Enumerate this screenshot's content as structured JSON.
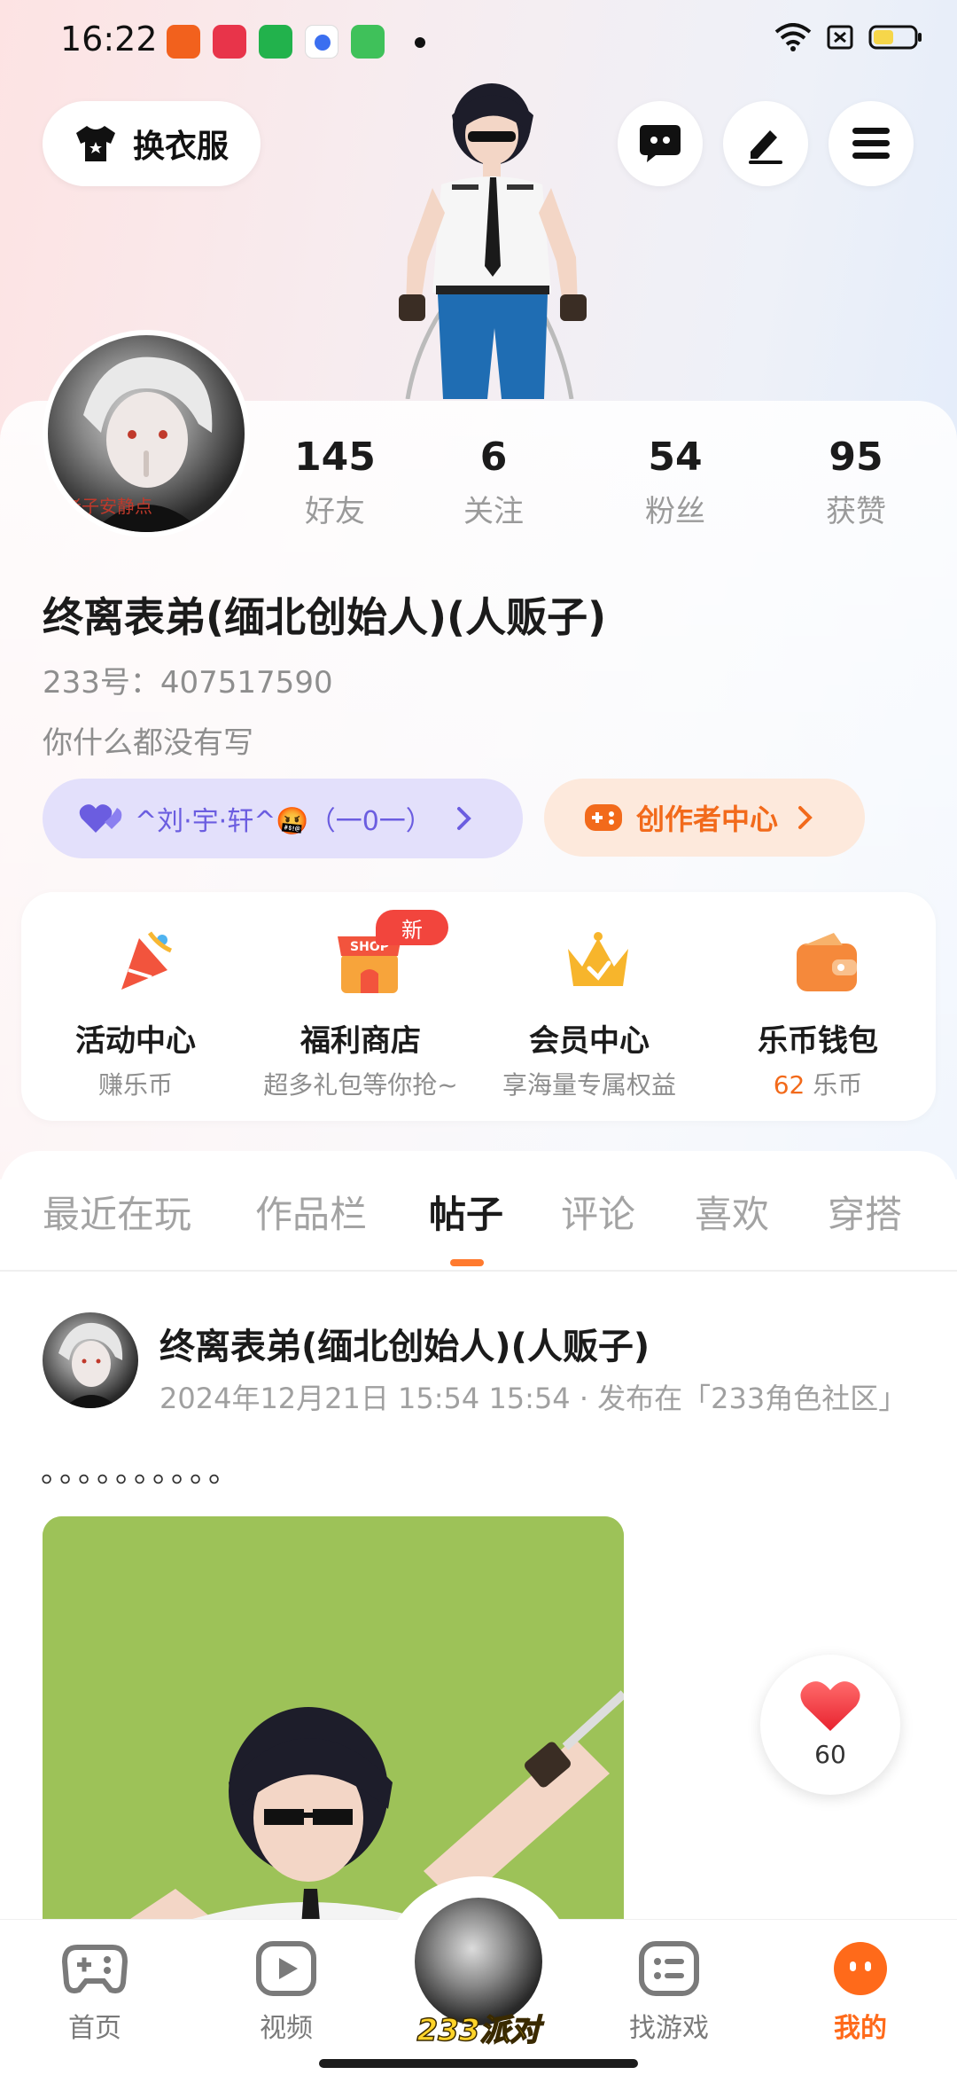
{
  "status_bar": {
    "time": "16:22",
    "app_icons": [
      {
        "name": "app-icon-orange",
        "color": "#f2611d"
      },
      {
        "name": "app-icon-red",
        "color": "#e8344a"
      },
      {
        "name": "app-icon-green",
        "color": "#22b24c"
      },
      {
        "name": "app-icon-baidu",
        "color": "#3b6ff0"
      },
      {
        "name": "app-icon-store",
        "color": "#3fc15a"
      }
    ]
  },
  "header": {
    "outfit_label": "换衣服"
  },
  "profile": {
    "stats": [
      {
        "num": "145",
        "label": "好友"
      },
      {
        "num": "6",
        "label": "关注"
      },
      {
        "num": "54",
        "label": "粉丝"
      },
      {
        "num": "95",
        "label": "获赞"
      }
    ],
    "username": "终离表弟(缅北创始人)(人贩子)",
    "id_line": "233号：407517590",
    "bio": "你什么都没有写",
    "friend_pill": "^刘·宇·轩^🤬（一0一）",
    "creator_label": "创作者中心"
  },
  "features": [
    {
      "title": "活动中心",
      "subtitle": "赚乐币",
      "icon": "party-icon"
    },
    {
      "title": "福利商店",
      "subtitle": "超多礼包等你抢~",
      "icon": "shop-icon",
      "icon_text": "SHOP"
    },
    {
      "title": "会员中心",
      "subtitle": "享海量专属权益",
      "icon": "crown-icon"
    },
    {
      "title": "乐币钱包",
      "subtitle_num": "62",
      "subtitle_unit": " 乐币",
      "icon": "wallet-icon"
    }
  ],
  "new_badge": "新",
  "tabs": [
    "最近在玩",
    "作品栏",
    "帖子",
    "评论",
    "喜欢",
    "穿搭"
  ],
  "active_tab": 2,
  "post": {
    "author": "终离表弟(缅北创始人)(人贩子)",
    "meta": "2024年12月21日 15:54 15:54 · 发布在「233角色社区」",
    "text": "。。。。。。。。。。"
  },
  "like": {
    "count": "60"
  },
  "bottom_nav": {
    "home": "首页",
    "video": "视频",
    "center": "233派对",
    "games": "找游戏",
    "mine": "我的"
  },
  "colors": {
    "accent": "#ff6a1a",
    "creator": "#f26a1b",
    "friend_pill": "#6b5de0"
  }
}
